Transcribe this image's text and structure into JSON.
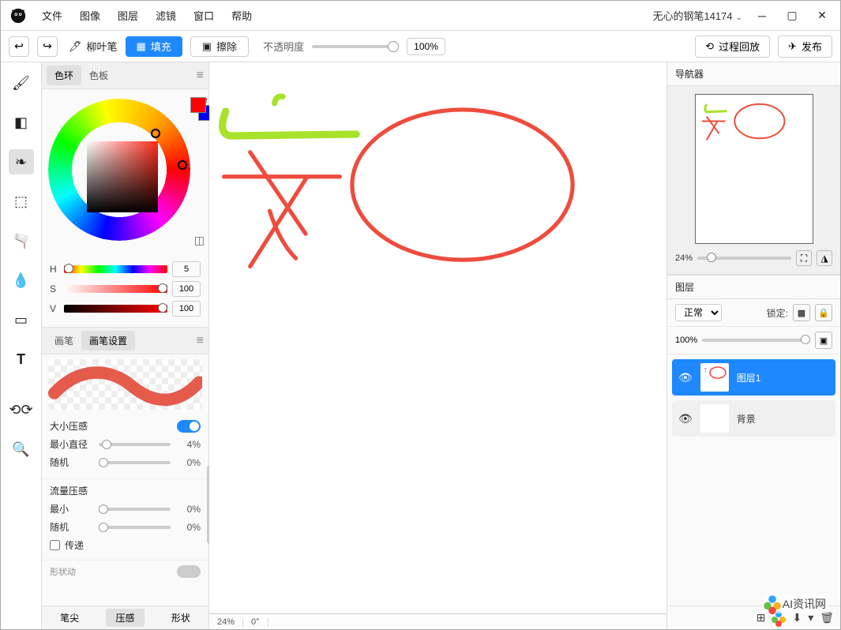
{
  "menu": {
    "items": [
      "文件",
      "图像",
      "图层",
      "滤镜",
      "窗口",
      "帮助"
    ]
  },
  "user": "无心的钢笔14174",
  "toolbar": {
    "brush_name": "柳叶笔",
    "fill": "填充",
    "erase": "擦除",
    "opacity_label": "不透明度",
    "opacity_value": "100%",
    "playback": "过程回放",
    "publish": "发布"
  },
  "color_tabs": {
    "ring": "色环",
    "palette": "色板"
  },
  "hsv": {
    "h": {
      "label": "H",
      "value": "5"
    },
    "s": {
      "label": "S",
      "value": "100"
    },
    "v": {
      "label": "V",
      "value": "100"
    }
  },
  "brush_tabs": {
    "brush": "画笔",
    "settings": "画笔设置"
  },
  "size_pressure": {
    "head": "大小压感",
    "min_diam": {
      "label": "最小直径",
      "value": "4%"
    },
    "random": {
      "label": "随机",
      "value": "0%"
    }
  },
  "flow_pressure": {
    "head": "流量压感",
    "min": {
      "label": "最小",
      "value": "0%"
    },
    "random": {
      "label": "随机",
      "value": "0%"
    },
    "pass": "传递"
  },
  "extra_head": "形状动",
  "bottom_tabs": {
    "tip": "笔尖",
    "pressure": "压感",
    "shape": "形状"
  },
  "status": {
    "zoom": "24%",
    "angle": "0°"
  },
  "nav": {
    "title": "导航器",
    "zoom": "24%"
  },
  "layers_panel": {
    "title": "图层",
    "blend": "正常",
    "lock_label": "锁定:",
    "opacity": "100%",
    "items": [
      {
        "name": "图层1",
        "active": true
      },
      {
        "name": "背景",
        "active": false
      }
    ]
  },
  "colors": {
    "accent": "#1e88ff",
    "red": "#ee4c3d",
    "green": "#a8e22a"
  },
  "ai_badge": "AI资讯网"
}
